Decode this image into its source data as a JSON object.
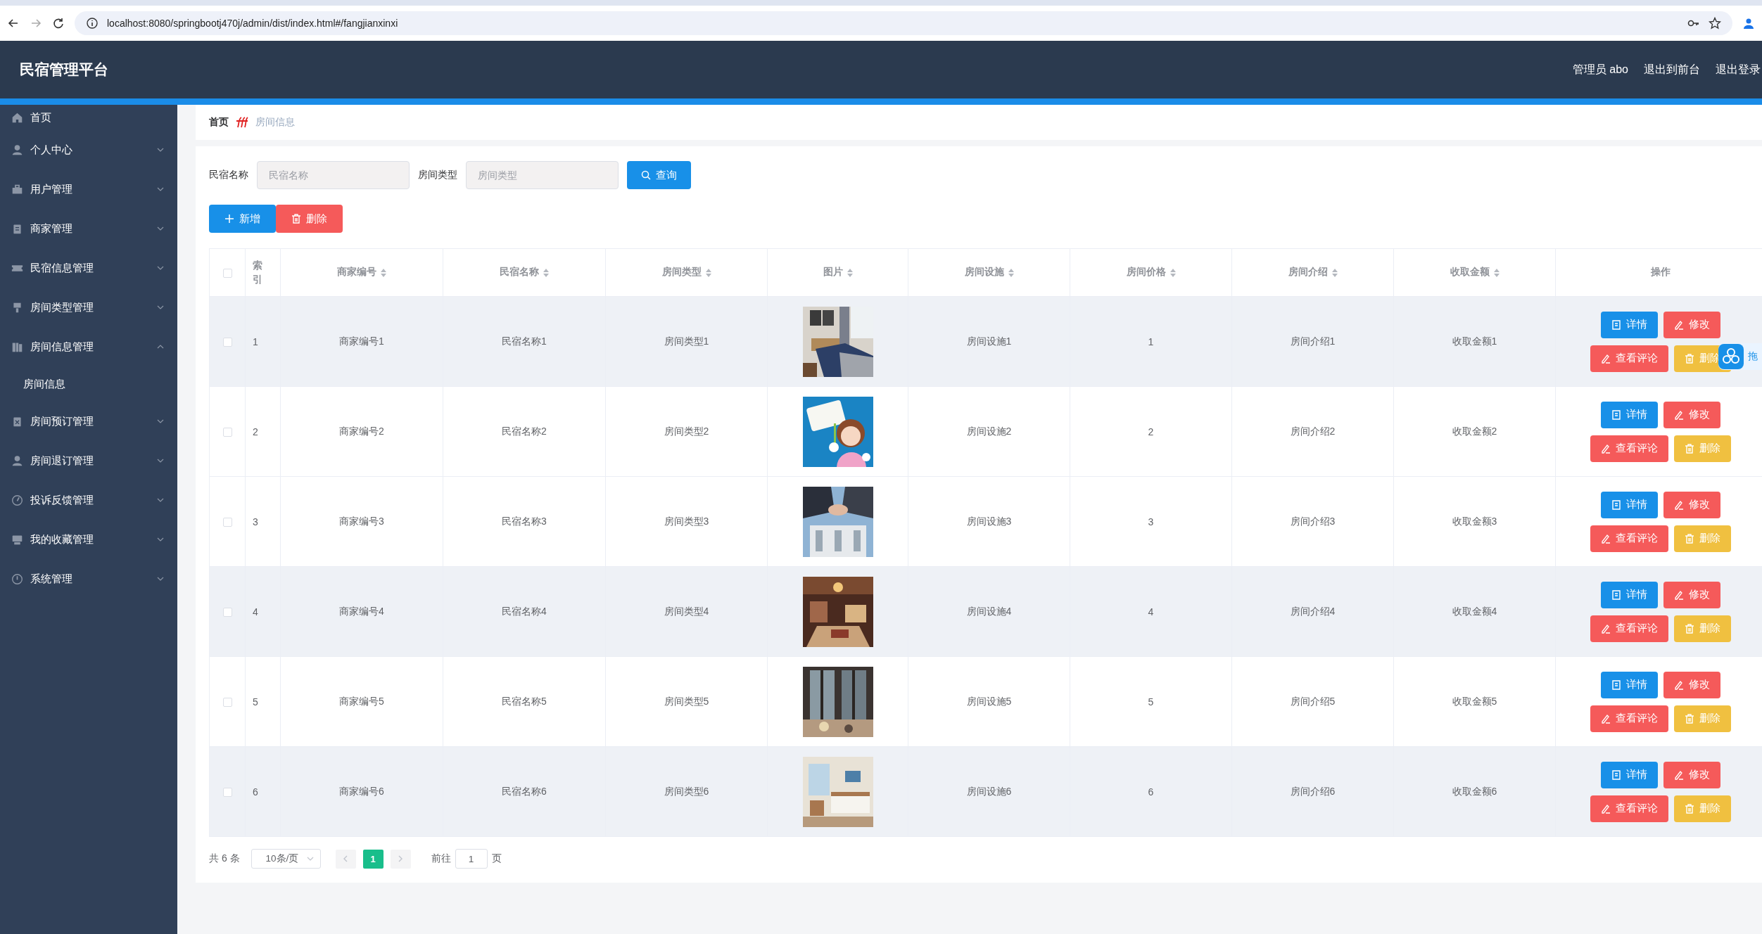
{
  "browser": {
    "url": "localhost:8080/springbootj470j/admin/dist/index.html#/fangjianxinxi"
  },
  "header": {
    "title": "民宿管理平台",
    "user": "管理员 abo",
    "links": [
      "退出到前台",
      "退出登录"
    ]
  },
  "sidebar": {
    "items": [
      {
        "label": "首页"
      },
      {
        "label": "个人中心",
        "expanded": false
      },
      {
        "label": "用户管理",
        "expanded": false
      },
      {
        "label": "商家管理",
        "expanded": false
      },
      {
        "label": "民宿信息管理",
        "expanded": false
      },
      {
        "label": "房间类型管理",
        "expanded": false
      },
      {
        "label": "房间信息管理",
        "expanded": true,
        "children": [
          {
            "label": "房间信息"
          }
        ]
      },
      {
        "label": "房间预订管理",
        "expanded": false
      },
      {
        "label": "房间退订管理",
        "expanded": false
      },
      {
        "label": "投诉反馈管理",
        "expanded": false
      },
      {
        "label": "我的收藏管理",
        "expanded": false
      },
      {
        "label": "系统管理",
        "expanded": false
      }
    ]
  },
  "breadcrumb": [
    "首页",
    "房间信息"
  ],
  "search": {
    "fields": [
      {
        "label": "民宿名称",
        "placeholder": "民宿名称"
      },
      {
        "label": "房间类型",
        "placeholder": "房间类型"
      }
    ],
    "button": "查询"
  },
  "actions": [
    {
      "label": "新增",
      "kind": "add"
    },
    {
      "label": "删除",
      "kind": "delete"
    }
  ],
  "table": {
    "select_all_checked": false,
    "columns": [
      {
        "label": "索引",
        "sortable": false
      },
      {
        "label": "商家编号",
        "sortable": true
      },
      {
        "label": "民宿名称",
        "sortable": true
      },
      {
        "label": "房间类型",
        "sortable": true
      },
      {
        "label": "图片",
        "sortable": true
      },
      {
        "label": "房间设施",
        "sortable": true
      },
      {
        "label": "房间价格",
        "sortable": true
      },
      {
        "label": "房间介绍",
        "sortable": true
      },
      {
        "label": "收取金额",
        "sortable": true
      },
      {
        "label": "操作",
        "sortable": false
      }
    ],
    "rows": [
      {
        "checked": false,
        "highlighted": true,
        "cells": [
          "1",
          "商家编号1",
          "民宿名称1",
          "房间类型1",
          {
            "kind": "picture"
          },
          "房间设施1",
          "1",
          "房间介绍1",
          "收取金额1",
          {
            "kind": "actions",
            "actions": [
              {
                "label": "详情",
                "kind": "detail"
              },
              {
                "label": "修改",
                "kind": "edit"
              },
              {
                "label": "查看评论",
                "kind": "comments"
              },
              {
                "label": "删除",
                "kind": "delete"
              }
            ]
          }
        ]
      },
      {
        "checked": false,
        "highlighted": false,
        "cells": [
          "2",
          "商家编号2",
          "民宿名称2",
          "房间类型2",
          {
            "kind": "picture"
          },
          "房间设施2",
          "2",
          "房间介绍2",
          "收取金额2",
          {
            "kind": "actions",
            "actions": [
              {
                "label": "详情",
                "kind": "detail"
              },
              {
                "label": "修改",
                "kind": "edit"
              },
              {
                "label": "查看评论",
                "kind": "comments"
              },
              {
                "label": "删除",
                "kind": "delete"
              }
            ]
          }
        ]
      },
      {
        "checked": false,
        "highlighted": false,
        "cells": [
          "3",
          "商家编号3",
          "民宿名称3",
          "房间类型3",
          {
            "kind": "picture"
          },
          "房间设施3",
          "3",
          "房间介绍3",
          "收取金额3",
          {
            "kind": "actions",
            "actions": [
              {
                "label": "详情",
                "kind": "detail"
              },
              {
                "label": "修改",
                "kind": "edit"
              },
              {
                "label": "查看评论",
                "kind": "comments"
              },
              {
                "label": "删除",
                "kind": "delete"
              }
            ]
          }
        ]
      },
      {
        "checked": false,
        "highlighted": true,
        "cells": [
          "4",
          "商家编号4",
          "民宿名称4",
          "房间类型4",
          {
            "kind": "picture"
          },
          "房间设施4",
          "4",
          "房间介绍4",
          "收取金额4",
          {
            "kind": "actions",
            "actions": [
              {
                "label": "详情",
                "kind": "detail"
              },
              {
                "label": "修改",
                "kind": "edit"
              },
              {
                "label": "查看评论",
                "kind": "comments"
              },
              {
                "label": "删除",
                "kind": "delete"
              }
            ]
          }
        ]
      },
      {
        "checked": false,
        "highlighted": false,
        "cells": [
          "5",
          "商家编号5",
          "民宿名称5",
          "房间类型5",
          {
            "kind": "picture"
          },
          "房间设施5",
          "5",
          "房间介绍5",
          "收取金额5",
          {
            "kind": "actions",
            "actions": [
              {
                "label": "详情",
                "kind": "detail"
              },
              {
                "label": "修改",
                "kind": "edit"
              },
              {
                "label": "查看评论",
                "kind": "comments"
              },
              {
                "label": "删除",
                "kind": "delete"
              }
            ]
          }
        ]
      },
      {
        "checked": false,
        "highlighted": true,
        "cells": [
          "6",
          "商家编号6",
          "民宿名称6",
          "房间类型6",
          {
            "kind": "picture"
          },
          "房间设施6",
          "6",
          "房间介绍6",
          "收取金额6",
          {
            "kind": "actions",
            "actions": [
              {
                "label": "详情",
                "kind": "detail"
              },
              {
                "label": "修改",
                "kind": "edit"
              },
              {
                "label": "查看评论",
                "kind": "comments"
              },
              {
                "label": "删除",
                "kind": "delete"
              }
            ]
          }
        ]
      }
    ]
  },
  "pagination": {
    "total": "共 6 条",
    "page_size": "10条/页",
    "pages": [
      {
        "label": "1",
        "selected": true
      }
    ],
    "jump_label": "前往",
    "jump_value": "1",
    "jump_suffix": "页"
  },
  "floating_widget": {
    "text": "拖"
  }
}
